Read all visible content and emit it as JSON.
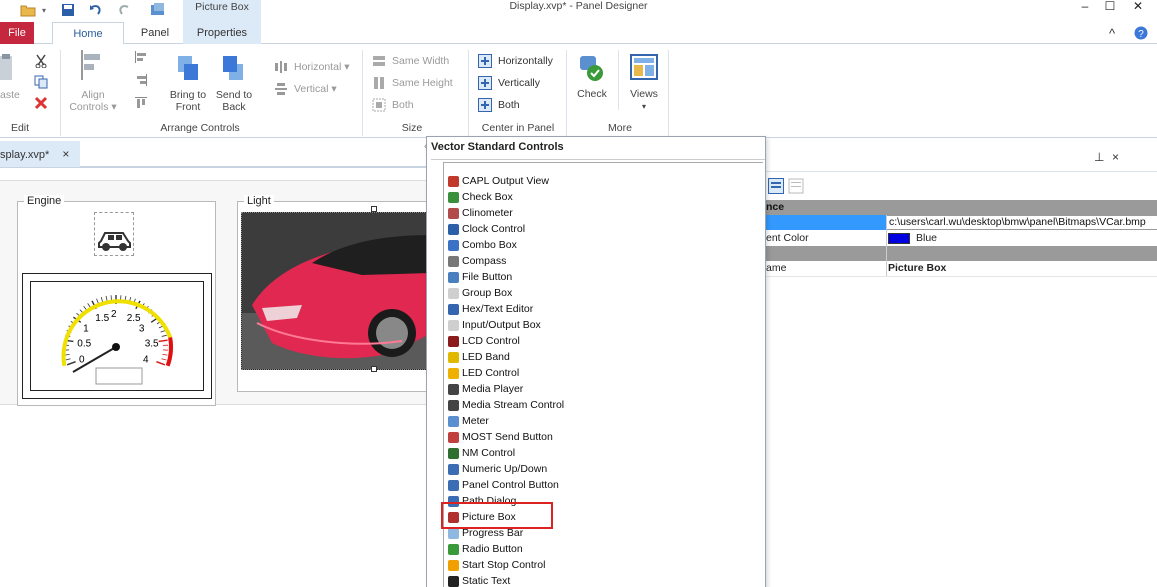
{
  "window": {
    "title": "Display.xvp* - Panel Designer",
    "context_tab_header": "Picture Box",
    "minimize": "–",
    "maximize": "☐",
    "close": "✕"
  },
  "ribbon": {
    "tabs": {
      "file": "File",
      "home": "Home",
      "panel": "Panel",
      "properties": "Properties"
    },
    "collapse_glyph": "^",
    "edit": {
      "group_label": "Edit",
      "paste_label": "aste"
    },
    "arrange": {
      "group_label": "Arrange Controls",
      "align_label_1": "Align",
      "align_label_2": "Controls ▾",
      "bring_label_1": "Bring to",
      "bring_label_2": "Front",
      "send_label_1": "Send to",
      "send_label_2": "Back",
      "horizontal": "Horizontal ▾",
      "vertical": "Vertical ▾"
    },
    "size": {
      "group_label": "Size",
      "same_width": "Same Width",
      "same_height": "Same Height",
      "both": "Both"
    },
    "center": {
      "group_label": "Center in Panel",
      "horizontally": "Horizontally",
      "vertically": "Vertically",
      "both": "Both"
    },
    "more": {
      "group_label": "More",
      "check": "Check",
      "views": "Views",
      "views_arrow": "▾"
    }
  },
  "doc_tab": {
    "label": "splay.xvp*",
    "close": "×"
  },
  "canvas": {
    "engine_title": "Engine",
    "light_title": "Light",
    "gauge_labels": [
      "0",
      "0.5",
      "1",
      "1.5",
      "2",
      "2.5",
      "3",
      "3.5",
      "4"
    ]
  },
  "properties_panel": {
    "pin": "⊥",
    "close": "×",
    "category_appearance": "nce",
    "image_path": "c:\\users\\carl.wu\\desktop\\bmw\\panel\\Bitmaps\\VCar.bmp",
    "row2_name": "ent Color",
    "row2_value": "Blue",
    "row3_name": "ame",
    "row3_value": "Picture Box",
    "transparent_color": "#0000e0"
  },
  "dropdown": {
    "title": "Vector Standard Controls",
    "items": [
      "CAPL Output View",
      "Check Box",
      "Clinometer",
      "Clock Control",
      "Combo Box",
      "Compass",
      "File Button",
      "Group Box",
      "Hex/Text Editor",
      "Input/Output Box",
      "LCD Control",
      "LED Band",
      "LED Control",
      "Media Player",
      "Media Stream Control",
      "Meter",
      "MOST Send Button",
      "NM Control",
      "Numeric Up/Down",
      "Panel Control Button",
      "Path Dialog",
      "Picture Box",
      "Progress Bar",
      "Radio Button",
      "Start Stop Control",
      "Static Text"
    ],
    "icon_colors": [
      "#c0392b",
      "#3a8f3a",
      "#b24a4a",
      "#2b5fa8",
      "#3a72c6",
      "#777777",
      "#4a7fbf",
      "#cfcfcf",
      "#3466b0",
      "#cfcfcf",
      "#8b1a1a",
      "#e0b800",
      "#f0b000",
      "#444444",
      "#444444",
      "#5a8fd0",
      "#c04040",
      "#2f6f2f",
      "#3b6db5",
      "#3b6db5",
      "#3b6db5",
      "#b03030",
      "#8fb8e0",
      "#3a9a3a",
      "#f0a000",
      "#222222"
    ],
    "selected": "Picture Box",
    "highlight_color": "#dd2222"
  }
}
